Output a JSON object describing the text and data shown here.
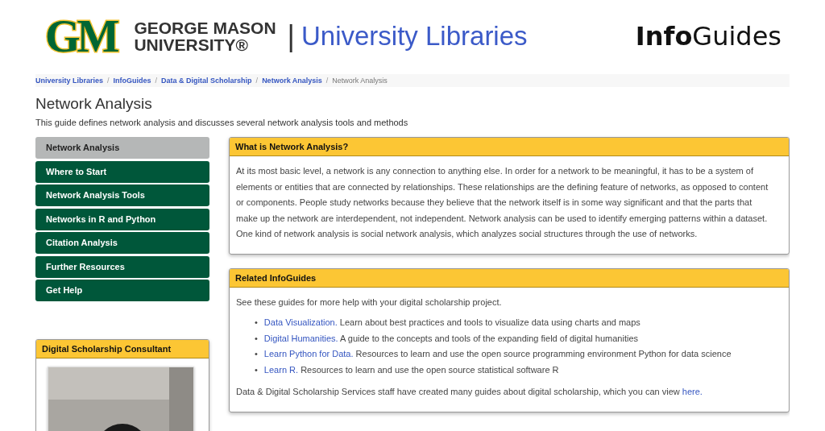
{
  "header": {
    "logo_mark": "GM",
    "logo_line_1": "GEORGE MASON",
    "logo_line_2": "UNIVERSITY®",
    "separator": "|",
    "site_name": "University Libraries",
    "brand": "**Info**Guides"
  },
  "breadcrumbs": [
    {
      "label": "University Libraries",
      "current": false
    },
    {
      "separator": "/",
      "label": "InfoGuides",
      "current": false
    },
    {
      "separator": "/",
      "label": "Data & Digital Scholarship",
      "current": false
    },
    {
      "separator": "/",
      "label": "Network Analysis",
      "current": false
    },
    {
      "separator": "/",
      "label": "Network Analysis",
      "current": true
    }
  ],
  "page": {
    "title": "Network Analysis",
    "description": "This guide defines network analysis and discusses several network analysis tools and methods"
  },
  "sidebar": {
    "items": [
      {
        "label": "Network Analysis",
        "selected": true
      },
      {
        "label": "Where to Start",
        "selected": false
      },
      {
        "label": "Network Analysis Tools",
        "selected": false
      },
      {
        "label": "Networks in R and Python",
        "selected": false
      },
      {
        "label": "Citation Analysis",
        "selected": false
      },
      {
        "label": "Further Resources",
        "selected": false
      },
      {
        "label": "Get Help",
        "selected": false
      }
    ],
    "consultant": {
      "title": "Digital Scholarship Consultant"
    }
  },
  "boxes": [
    {
      "title": "What is Network Analysis?",
      "paragraphs": [
        "At its most basic level, a network is any connection to anything else. In order for a network to be meaningful, it has to be a system of elements or entities that are connected by relationships. These relationships are the defining feature of networks, as opposed to content or components. People study networks because they believe that the network itself is in some way significant and that the parts that make up the network are interdependent, not independent. Network analysis can be used to identify emerging patterns within a dataset. One kind of network analysis is social network analysis, which analyzes social structures through the use of networks."
      ]
    },
    {
      "title": "Related InfoGuides",
      "intro": "See these guides for more help with your digital scholarship project.",
      "bullet": "•",
      "links": [
        {
          "link": "Data Visualization.",
          "text": "Learn about best practices and tools to visualize data using charts and maps"
        },
        {
          "link": "Digital Humanities.",
          "text": "A guide to the concepts and tools of the expanding field of digital humanities"
        },
        {
          "link": "Learn Python for Data.",
          "text": "Resources to learn and use the open source programming environment Python for data science"
        },
        {
          "link": "Learn R.",
          "text": "Resources to learn and use the open source statistical software R"
        }
      ],
      "outro": "Data & Digital Scholarship Services staff have created many guides about digital scholarship, which you can view",
      "outro_link": "here."
    }
  ]
}
